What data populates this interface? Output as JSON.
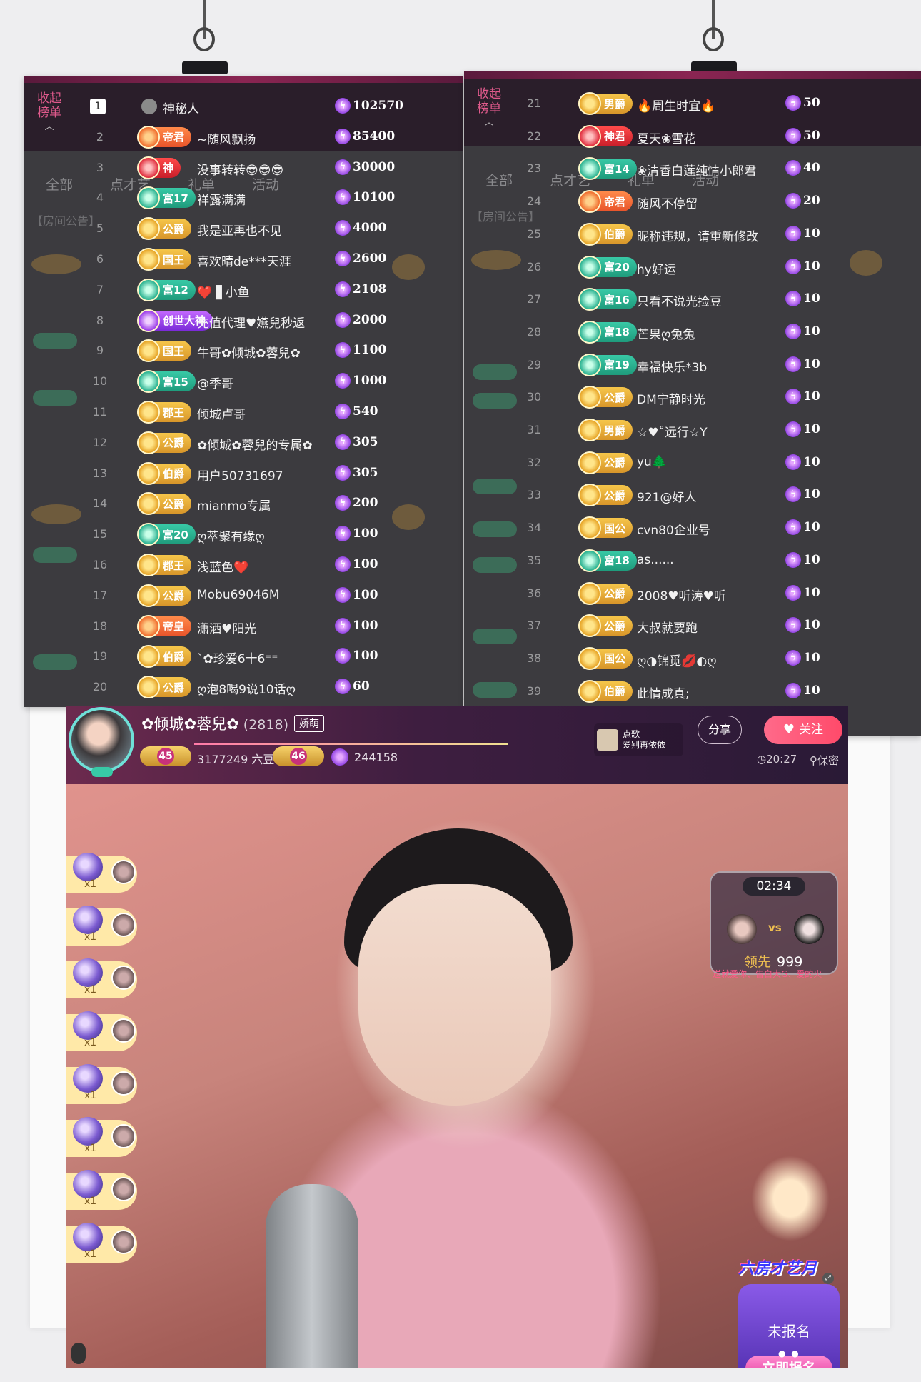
{
  "left_panel": {
    "collapse_label": "收起\n榜单",
    "bg_tabs": [
      "全部",
      "点才艺",
      "礼单",
      "活动"
    ],
    "bg_announcement": "【房间公告】",
    "rows": [
      {
        "rank": "1",
        "badge": "",
        "tier": "",
        "name": "神秘人",
        "value": "102570"
      },
      {
        "rank": "2",
        "badge": "帝君",
        "tier": "orange",
        "name": "~随风飘扬",
        "value": "85400"
      },
      {
        "rank": "3",
        "badge": "神",
        "tier": "red",
        "name": "没事转转😎😎😎",
        "value": "30000"
      },
      {
        "rank": "4",
        "badge": "富17",
        "tier": "green",
        "name": "祥露满满",
        "value": "10100"
      },
      {
        "rank": "5",
        "badge": "公爵",
        "tier": "gold",
        "name": "我是亚再也不见",
        "value": "4000"
      },
      {
        "rank": "6",
        "badge": "国王",
        "tier": "gold",
        "name": "喜欢晴de***天涯",
        "value": "2600"
      },
      {
        "rank": "7",
        "badge": "富12",
        "tier": "green",
        "name": "❤️ ▋小鱼",
        "value": "2108"
      },
      {
        "rank": "8",
        "badge": "创世大神",
        "tier": "purple",
        "name": "充值代理♥嬿兒秒返",
        "value": "2000"
      },
      {
        "rank": "9",
        "badge": "国王",
        "tier": "gold",
        "name": "牛哥✿倾城✿蓉兒✿",
        "value": "1100"
      },
      {
        "rank": "10",
        "badge": "富15",
        "tier": "green",
        "name": "@季哥",
        "value": "1000"
      },
      {
        "rank": "11",
        "badge": "郡王",
        "tier": "gold",
        "name": "倾城卢哥",
        "value": "540"
      },
      {
        "rank": "12",
        "badge": "公爵",
        "tier": "gold",
        "name": "✿倾城✿蓉兒的专属✿",
        "value": "305"
      },
      {
        "rank": "13",
        "badge": "伯爵",
        "tier": "gold",
        "name": "用户50731697",
        "value": "305"
      },
      {
        "rank": "14",
        "badge": "公爵",
        "tier": "gold",
        "name": "mianmo专属",
        "value": "200"
      },
      {
        "rank": "15",
        "badge": "富20",
        "tier": "green",
        "name": "ღ萃聚有缘ღ",
        "value": "100"
      },
      {
        "rank": "16",
        "badge": "郡王",
        "tier": "gold",
        "name": "浅蓝色❤️",
        "value": "100"
      },
      {
        "rank": "17",
        "badge": "公爵",
        "tier": "gold",
        "name": "Mobu69046M",
        "value": "100"
      },
      {
        "rank": "18",
        "badge": "帝皇",
        "tier": "orange",
        "name": "潇洒♥阳光",
        "value": "100"
      },
      {
        "rank": "19",
        "badge": "伯爵",
        "tier": "gold",
        "name": "`✿珍爱6十6⁼⁼",
        "value": "100"
      },
      {
        "rank": "20",
        "badge": "公爵",
        "tier": "gold",
        "name": "ღ泡8喝9说10话ღ",
        "value": "60"
      }
    ]
  },
  "right_panel": {
    "collapse_label": "收起\n榜单",
    "bg_tabs": [
      "全部",
      "点才艺",
      "礼单",
      "活动"
    ],
    "bg_announcement": "【房间公告】",
    "rows": [
      {
        "rank": "21",
        "badge": "男爵",
        "tier": "gold",
        "name": "🔥周生时宜🔥",
        "value": "50"
      },
      {
        "rank": "22",
        "badge": "神君",
        "tier": "red",
        "name": "夏天❀雪花",
        "value": "50"
      },
      {
        "rank": "23",
        "badge": "富14",
        "tier": "green",
        "name": "❀清香白莲纯情小郎君",
        "value": "40"
      },
      {
        "rank": "24",
        "badge": "帝君",
        "tier": "orange",
        "name": "随风不停留",
        "value": "20"
      },
      {
        "rank": "25",
        "badge": "伯爵",
        "tier": "gold",
        "name": "昵称违规，请重新修改",
        "value": "10"
      },
      {
        "rank": "26",
        "badge": "富20",
        "tier": "green",
        "name": "hy好运",
        "value": "10"
      },
      {
        "rank": "27",
        "badge": "富16",
        "tier": "green",
        "name": "只看不说光捡豆",
        "value": "10"
      },
      {
        "rank": "28",
        "badge": "富18",
        "tier": "green",
        "name": "芒果ღ兔兔",
        "value": "10"
      },
      {
        "rank": "29",
        "badge": "富19",
        "tier": "green",
        "name": "幸福快乐*3b",
        "value": "10"
      },
      {
        "rank": "30",
        "badge": "公爵",
        "tier": "gold",
        "name": "DM宁静时光",
        "value": "10"
      },
      {
        "rank": "31",
        "badge": "男爵",
        "tier": "gold",
        "name": "☆♥˚远行☆Y",
        "value": "10"
      },
      {
        "rank": "32",
        "badge": "公爵",
        "tier": "gold",
        "name": "yu🌲",
        "value": "10"
      },
      {
        "rank": "33",
        "badge": "公爵",
        "tier": "gold",
        "name": "921@好人",
        "value": "10"
      },
      {
        "rank": "34",
        "badge": "国公",
        "tier": "gold",
        "name": "cvn80企业号",
        "value": "10"
      },
      {
        "rank": "35",
        "badge": "富18",
        "tier": "green",
        "name": "as......",
        "value": "10"
      },
      {
        "rank": "36",
        "badge": "公爵",
        "tier": "gold",
        "name": "2008♥听涛♥听",
        "value": "10"
      },
      {
        "rank": "37",
        "badge": "公爵",
        "tier": "gold",
        "name": "大叔就要跑",
        "value": "10"
      },
      {
        "rank": "38",
        "badge": "国公",
        "tier": "gold",
        "name": "ღ◑锦觅💋◐ღ",
        "value": "10"
      },
      {
        "rank": "39",
        "badge": "伯爵",
        "tier": "gold",
        "name": "此情成真;",
        "value": "10"
      }
    ]
  },
  "room": {
    "host_name": "✿倾城✿蓉兒✿",
    "room_number": "(2818)",
    "tag": "娇萌",
    "level_left": "45",
    "level_right": "46",
    "beans": "3177249 六豆",
    "points": "244158",
    "song_label": "点歌\n爱别再依依",
    "share_label": "分享",
    "follow_label": "关注",
    "time": "20:27",
    "secret": "保密"
  },
  "gifts": [
    "x1",
    "x1",
    "x1",
    "x1",
    "x1",
    "x1",
    "x1",
    "x1"
  ],
  "pk": {
    "timer": "02:34",
    "vs": "vs",
    "lead_label": "领先",
    "lead_value": "999",
    "ticker": "送就爱你、告白大G、爱的火"
  },
  "event": {
    "title": "六房才艺月",
    "status": "未报名",
    "button": "立即报名"
  },
  "colors": {
    "accent_pink": "#ff4a6a",
    "panel_bg": "#3c3b3f",
    "header_bg": "#3e1e40",
    "badge_gold": "#f6c64a",
    "badge_green": "#38c9a6"
  }
}
